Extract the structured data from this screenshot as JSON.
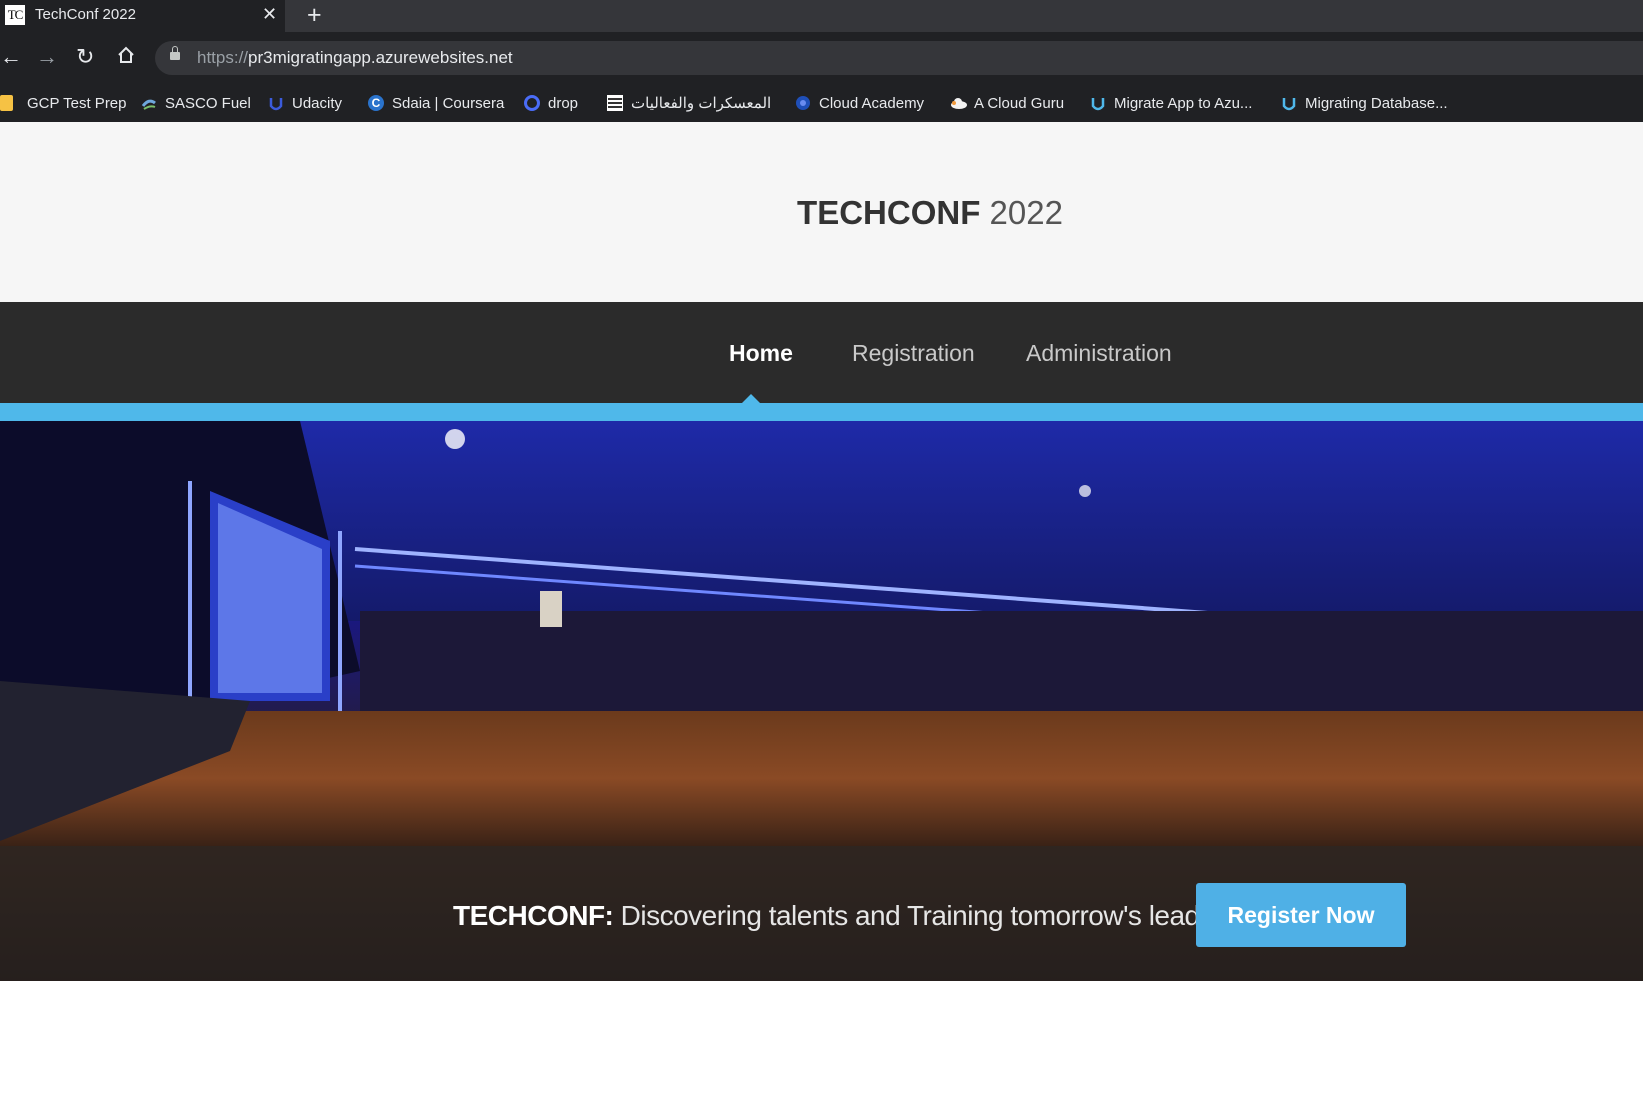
{
  "browser": {
    "tab": {
      "favicon_text": "TC",
      "title": "TechConf 2022",
      "close_icon": "close-icon"
    },
    "new_tab_icon": "plus-icon",
    "toolbar": {
      "back_icon": "back-arrow-icon",
      "forward_icon": "forward-arrow-icon",
      "reload_icon": "reload-icon",
      "home_icon": "home-icon",
      "url_scheme": "https://",
      "url_host": "pr3migratingapp.azurewebsites.net",
      "lock_icon": "lock-icon"
    },
    "bookmarks": [
      {
        "label": "GCP Test Prep",
        "icon": "folder-icon"
      },
      {
        "label": "SASCO Fuel",
        "icon": "sasco-icon"
      },
      {
        "label": "Udacity",
        "icon": "udacity-icon"
      },
      {
        "label": "Sdaia | Coursera",
        "icon": "coursera-icon"
      },
      {
        "label": "drop",
        "icon": "drop-icon"
      },
      {
        "label": "المعسكرات والفعاليات",
        "icon": "camps-icon"
      },
      {
        "label": "Cloud Academy",
        "icon": "cloud-academy-icon"
      },
      {
        "label": "A Cloud Guru",
        "icon": "cloud-guru-icon"
      },
      {
        "label": "Migrate App to Azu...",
        "icon": "udacity-icon"
      },
      {
        "label": "Migrating Database...",
        "icon": "udacity-icon"
      }
    ]
  },
  "site": {
    "title_bold": "TECHCONF",
    "title_year": " 2022",
    "nav": [
      {
        "label": "Home",
        "active": true
      },
      {
        "label": "Registration",
        "active": false
      },
      {
        "label": "Administration",
        "active": false
      }
    ],
    "accent_color": "#4fb8ea",
    "hero": {
      "tagline_bold": "TECHCONF:",
      "tagline_text": " Discovering talents and Training tomorrow's leaders",
      "register_label": "Register Now"
    }
  }
}
